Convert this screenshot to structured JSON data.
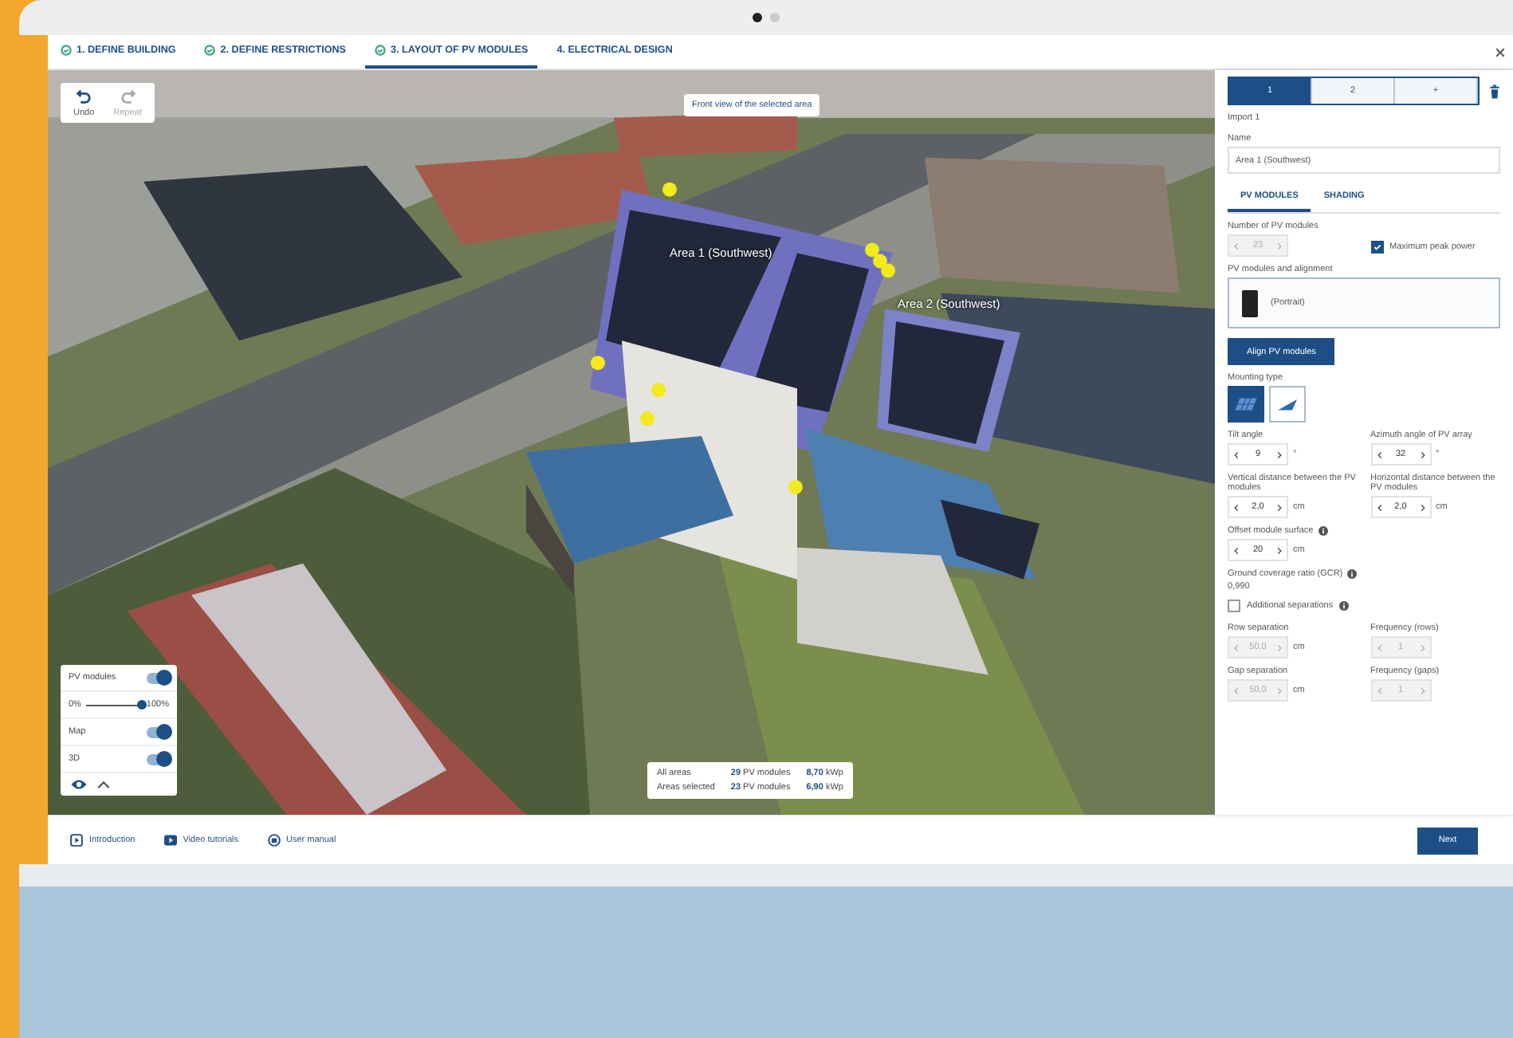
{
  "steps": [
    {
      "label": "1. DEFINE BUILDING",
      "done": true,
      "selected": false
    },
    {
      "label": "2. DEFINE RESTRICTIONS",
      "done": true,
      "selected": false
    },
    {
      "label": "3. LAYOUT OF PV MODULES",
      "done": true,
      "selected": true
    },
    {
      "label": "4. ELECTRICAL DESIGN",
      "done": false,
      "selected": false
    }
  ],
  "history": [
    {
      "kind": "undo",
      "label": "Undo",
      "disabled": false
    },
    {
      "kind": "redo",
      "label": "Repeat",
      "disabled": true
    }
  ],
  "map": {
    "tooltip": "Front view of the selected area",
    "area_labels": [
      "Area 1 (Southwest)",
      "Area 2 (Southwest)"
    ]
  },
  "layers": [
    {
      "kind": "toggle",
      "label": "PV modules",
      "on": true
    },
    {
      "kind": "slider",
      "min_label": "0%",
      "max_label": "100%",
      "level": 1
    },
    {
      "kind": "toggle",
      "label": "Map",
      "on": true
    },
    {
      "kind": "toggle",
      "label": "3D",
      "on": true
    }
  ],
  "summary": [
    {
      "label": "All areas",
      "count": "29",
      "unit": "PV modules",
      "power": "8,70",
      "power_unit": "kWp"
    },
    {
      "label": "Areas selected",
      "count": "23",
      "unit": "PV modules",
      "power": "6,90",
      "power_unit": "kWp"
    }
  ],
  "panel": {
    "area_buttons": [
      {
        "label": "1",
        "selected": true
      },
      {
        "label": "2",
        "selected": false
      },
      {
        "label": "+",
        "selected": false
      }
    ],
    "import_label": "Import 1",
    "name": {
      "label": "Name",
      "value": "Area 1 (Southwest)"
    },
    "tabs": [
      {
        "label": "PV MODULES",
        "selected": true
      },
      {
        "label": "SHADING",
        "selected": false
      }
    ],
    "module_count": {
      "label": "Number of PV modules",
      "value": "23",
      "disabled": true
    },
    "max_peak": {
      "label": "Maximum peak power",
      "checked": true
    },
    "alignment": {
      "label": "PV modules and alignment",
      "value": "(Portrait)"
    },
    "align_button": "Align PV modules",
    "mounting": {
      "label": "Mounting type",
      "options": [
        {
          "kind": "flat",
          "selected": true
        },
        {
          "kind": "tilted",
          "selected": false
        }
      ]
    },
    "fields": [
      {
        "label": "Tilt angle",
        "value": "9",
        "unit": "°",
        "disabled": false
      },
      {
        "label": "Azimuth angle of PV array",
        "value": "32",
        "unit": "°",
        "disabled": false
      },
      {
        "label": "Vertical distance between the PV modules",
        "value": "2,0",
        "unit": "cm",
        "disabled": false
      },
      {
        "label": "Horizontal distance between the PV modules",
        "value": "2,0",
        "unit": "cm",
        "disabled": false
      }
    ],
    "offset": {
      "label": "Offset module surface",
      "value": "20",
      "unit": "cm",
      "disabled": false
    },
    "gcr": {
      "label": "Ground coverage ratio (GCR)",
      "value": "0,990"
    },
    "additional": {
      "label": "Additional separations",
      "checked": false
    },
    "separations": [
      {
        "label": "Row separation",
        "value": "50,0",
        "unit": "cm",
        "disabled": true
      },
      {
        "label": "Frequency (rows)",
        "value": "1",
        "disabled": true
      },
      {
        "label": "Gap separation",
        "value": "50,0",
        "unit": "cm",
        "disabled": true
      },
      {
        "label": "Frequency (gaps)",
        "value": "1",
        "disabled": true
      }
    ]
  },
  "footer": {
    "links": [
      {
        "kind": "intro",
        "label": "Introduction"
      },
      {
        "kind": "video",
        "label": "Video tutorials"
      },
      {
        "kind": "manual",
        "label": "User manual"
      }
    ],
    "next": "Next"
  }
}
